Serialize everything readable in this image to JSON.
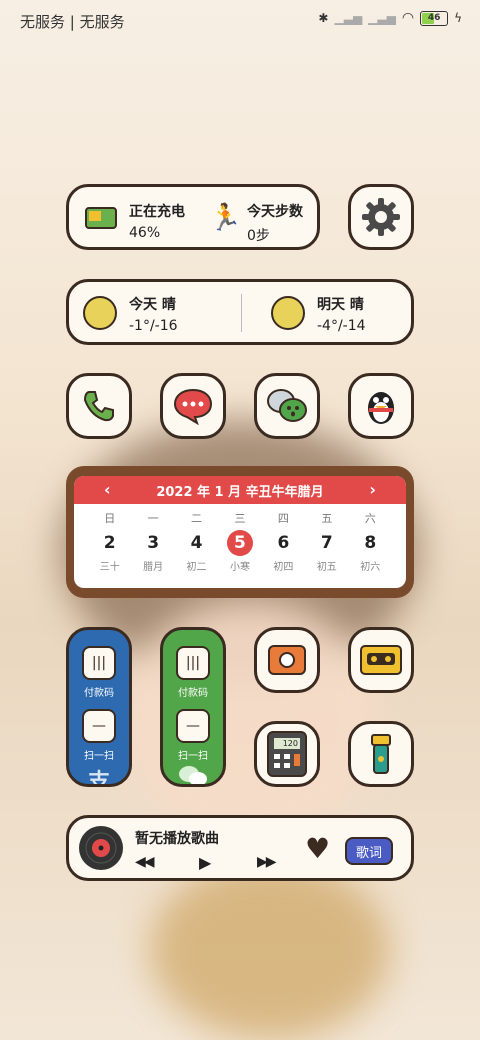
{
  "status": {
    "carrier": "无服务 | 无服务",
    "battery": "46"
  },
  "charge": {
    "title": "正在充电",
    "value": "46%"
  },
  "steps": {
    "title": "今天步数",
    "value": "0步"
  },
  "weather": {
    "today": {
      "label": "今天 晴",
      "temp": "-1°/-16"
    },
    "tomorrow": {
      "label": "明天 晴",
      "temp": "-4°/-14"
    }
  },
  "calendar": {
    "header": "2022 年 1 月  辛丑牛年腊月",
    "prev": "‹",
    "next": "›",
    "days": [
      {
        "week": "日",
        "date": "2",
        "lunar": "三十"
      },
      {
        "week": "一",
        "date": "3",
        "lunar": "腊月"
      },
      {
        "week": "二",
        "date": "4",
        "lunar": "初二"
      },
      {
        "week": "三",
        "date": "5",
        "lunar": "小寒"
      },
      {
        "week": "四",
        "date": "6",
        "lunar": "初四"
      },
      {
        "week": "五",
        "date": "7",
        "lunar": "初五"
      },
      {
        "week": "六",
        "date": "8",
        "lunar": "初六"
      }
    ]
  },
  "alipay": {
    "pay": "付款码",
    "scan": "扫一扫",
    "logo": "支"
  },
  "wechat": {
    "pay": "付款码",
    "scan": "扫一扫"
  },
  "calculator": {
    "display": "120"
  },
  "music": {
    "title": "暂无播放歌曲",
    "lyrics": "歌词"
  },
  "colors": {
    "accent": "#e24a4a",
    "border": "#3a2a20",
    "alipay": "#2d6ab0",
    "wechat": "#52a64a"
  }
}
